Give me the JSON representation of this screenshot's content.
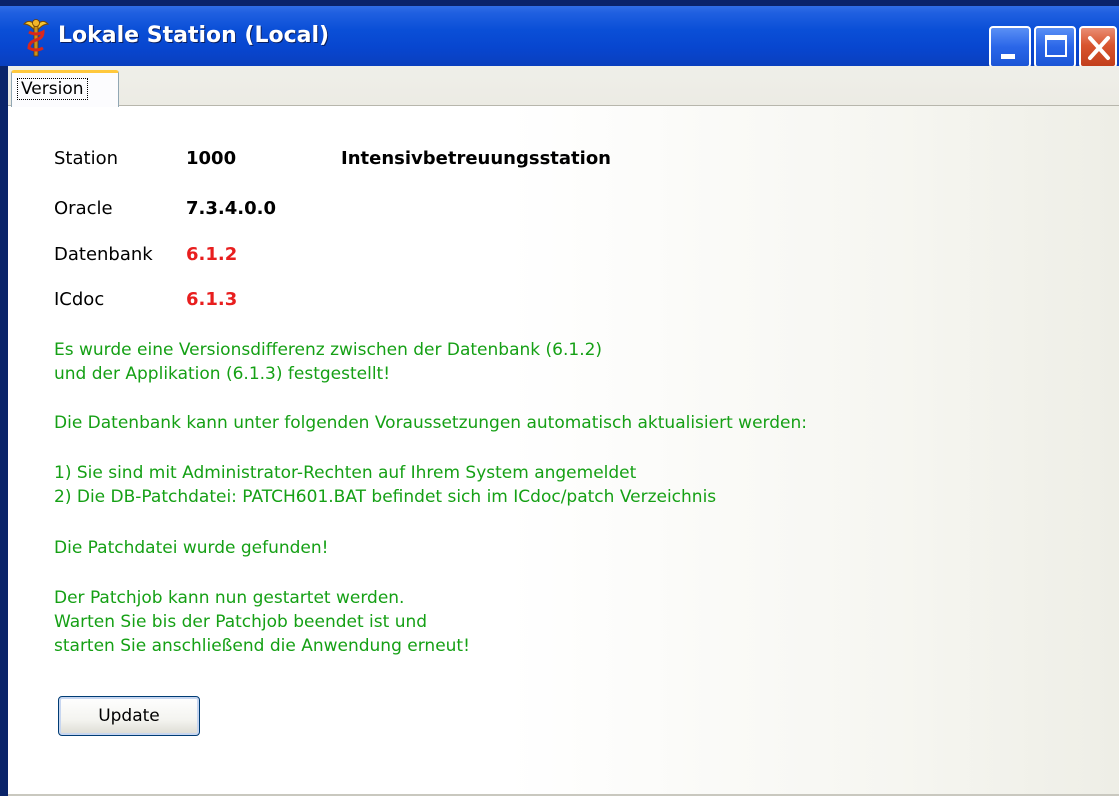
{
  "window": {
    "title": "Lokale Station (Local)",
    "icon": "caduceus-icon",
    "controls": [
      "minimize-icon",
      "maximize-icon",
      "close-icon"
    ]
  },
  "tabs": [
    {
      "label": "Version",
      "selected": true
    }
  ],
  "info": {
    "station_label": "Station",
    "station_value": "1000",
    "station_name": "Intensivbetreuungsstation",
    "oracle_label": "Oracle",
    "oracle_value": "7.3.4.0.0",
    "datenbank_label": "Datenbank",
    "datenbank_value": "6.1.2",
    "icdoc_label": "ICdoc",
    "icdoc_value": "6.1.3"
  },
  "messages": {
    "line1": "Es wurde eine Versionsdifferenz zwischen der Datenbank (6.1.2)",
    "line2": "und der Applikation (6.1.3) festgestellt!",
    "line3": "Die Datenbank kann unter folgenden Voraussetzungen automatisch aktualisiert werden:",
    "line4": "1) Sie sind mit Administrator-Rechten auf Ihrem System angemeldet",
    "line5": "2) Die DB-Patchdatei: PATCH601.BAT befindet sich im ICdoc/patch Verzeichnis",
    "line6": "Die Patchdatei wurde gefunden!",
    "line7": "Der Patchjob kann nun gestartet werden.",
    "line8": "Warten Sie bis der Patchjob beendet ist und",
    "line9": "starten Sie anschließend die Anwendung erneut!"
  },
  "buttons": {
    "update_label": "Update"
  },
  "colors": {
    "title_bar": "#0a4fd7",
    "message_text": "#15a015",
    "version_mismatch": "#e81e1e",
    "close_button": "#d9552f"
  }
}
